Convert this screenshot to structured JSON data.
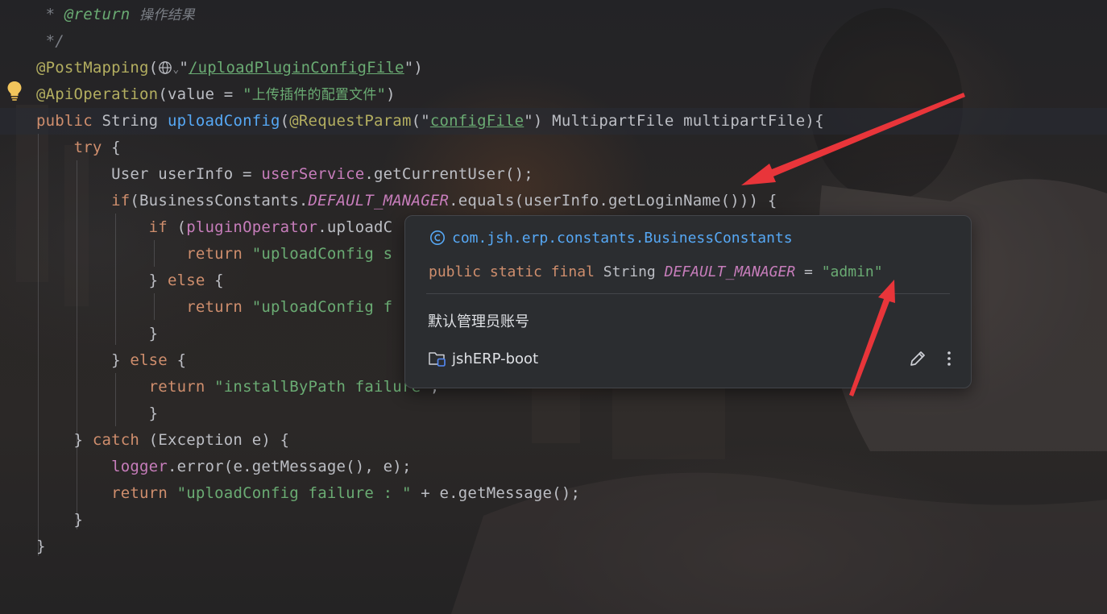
{
  "editor": {
    "lines": [
      {
        "id": "l1",
        "tokens": [
          [
            "cmt",
            " * "
          ],
          [
            "doctag",
            "@return"
          ],
          [
            "cmt",
            " "
          ],
          [
            "cmt cn",
            "操作结果"
          ]
        ]
      },
      {
        "id": "l2",
        "tokens": [
          [
            "cmt",
            " */"
          ]
        ]
      },
      {
        "id": "l3",
        "tokens": [
          [
            "ann",
            "@PostMapping"
          ],
          [
            "",
            "("
          ],
          [
            "globe",
            ""
          ],
          [
            "",
            "\""
          ],
          [
            "str udl",
            "/uploadPluginConfigFile"
          ],
          [
            "",
            "\")"
          ]
        ]
      },
      {
        "id": "l4",
        "tokens": [
          [
            "ann",
            "@ApiOperation"
          ],
          [
            "",
            "(value = "
          ],
          [
            "str",
            "\""
          ],
          [
            "str cn",
            "上传插件的配置文件"
          ],
          [
            "str",
            "\""
          ],
          [
            "",
            ")"
          ]
        ]
      },
      {
        "id": "l5",
        "tokens": [
          [
            "kw",
            "public"
          ],
          [
            "",
            " String "
          ],
          [
            "fn",
            "uploadConfig"
          ],
          [
            "",
            "("
          ],
          [
            "ann",
            "@RequestParam"
          ],
          [
            "",
            "(\""
          ],
          [
            "str udl",
            "configFile"
          ],
          [
            "",
            "\") MultipartFile multipartFile){"
          ]
        ]
      },
      {
        "id": "l6",
        "tokens": [
          [
            "",
            "    "
          ],
          [
            "kw",
            "try"
          ],
          [
            "",
            " {"
          ]
        ]
      },
      {
        "id": "l7",
        "tokens": [
          [
            "",
            "        User userInfo = "
          ],
          [
            "fld",
            "userService"
          ],
          [
            "",
            ".getCurrentUser();"
          ]
        ]
      },
      {
        "id": "l8",
        "tokens": [
          [
            "",
            "        "
          ],
          [
            "kw",
            "if"
          ],
          [
            "",
            "(BusinessConstants."
          ],
          [
            "cst",
            "DEFAULT_MANAGER"
          ],
          [
            "",
            ".equals(userInfo.getLoginName())) {"
          ]
        ]
      },
      {
        "id": "l9",
        "tokens": [
          [
            "",
            "            "
          ],
          [
            "kw",
            "if"
          ],
          [
            "",
            " ("
          ],
          [
            "fld",
            "pluginOperator"
          ],
          [
            "",
            ".uploadC"
          ]
        ]
      },
      {
        "id": "l10",
        "tokens": [
          [
            "",
            "                "
          ],
          [
            "kw",
            "return"
          ],
          [
            "",
            " "
          ],
          [
            "str",
            "\"uploadConfig s"
          ]
        ]
      },
      {
        "id": "l11",
        "tokens": [
          [
            "",
            "            } "
          ],
          [
            "kw",
            "else"
          ],
          [
            "",
            " {"
          ]
        ]
      },
      {
        "id": "l12",
        "tokens": [
          [
            "",
            "                "
          ],
          [
            "kw",
            "return"
          ],
          [
            "",
            " "
          ],
          [
            "str",
            "\"uploadConfig f"
          ]
        ]
      },
      {
        "id": "l13",
        "tokens": [
          [
            "",
            "            }"
          ]
        ]
      },
      {
        "id": "l14",
        "tokens": [
          [
            "",
            "        } "
          ],
          [
            "kw",
            "else"
          ],
          [
            "",
            " {"
          ]
        ]
      },
      {
        "id": "l15",
        "tokens": [
          [
            "",
            "            "
          ],
          [
            "kw",
            "return"
          ],
          [
            "",
            " "
          ],
          [
            "str",
            "\"installByPath failure\""
          ],
          [
            "",
            ";"
          ]
        ]
      },
      {
        "id": "l16",
        "tokens": [
          [
            "",
            "            }"
          ]
        ]
      },
      {
        "id": "l17",
        "tokens": [
          [
            "",
            "    } "
          ],
          [
            "kw",
            "catch"
          ],
          [
            "",
            " (Exception e) {"
          ]
        ]
      },
      {
        "id": "l18",
        "tokens": [
          [
            "",
            "        "
          ],
          [
            "fld",
            "logger"
          ],
          [
            "",
            ".error(e.getMessage(), e);"
          ]
        ]
      },
      {
        "id": "l19",
        "tokens": [
          [
            "",
            "        "
          ],
          [
            "kw",
            "return"
          ],
          [
            "",
            " "
          ],
          [
            "str",
            "\"uploadConfig failure : \""
          ],
          [
            "",
            " + e.getMessage();"
          ]
        ]
      },
      {
        "id": "l20",
        "tokens": [
          [
            "",
            "    }"
          ]
        ]
      },
      {
        "id": "l21",
        "tokens": [
          [
            "",
            "}"
          ]
        ]
      }
    ]
  },
  "popup": {
    "class_path": "com.jsh.erp.constants.BusinessConstants",
    "decl_modifiers": "public static final",
    "decl_type": "String",
    "decl_name": "DEFAULT_MANAGER",
    "decl_eq": "=",
    "decl_value": "\"admin\"",
    "description": "默认管理员账号",
    "module": "jshERP-boot"
  },
  "icons": [
    "intention-bulb-icon",
    "globe-icon",
    "class-c-icon",
    "module-folder-icon",
    "edit-pencil-icon",
    "more-vertical-icon",
    "red-arrow-annotation"
  ],
  "colors": {
    "keyword": "#cf8e6d",
    "annotation": "#b3ae60",
    "string": "#6aab73",
    "function": "#56a8f5",
    "field": "#c77dbb",
    "arrow": "#e8353a"
  }
}
